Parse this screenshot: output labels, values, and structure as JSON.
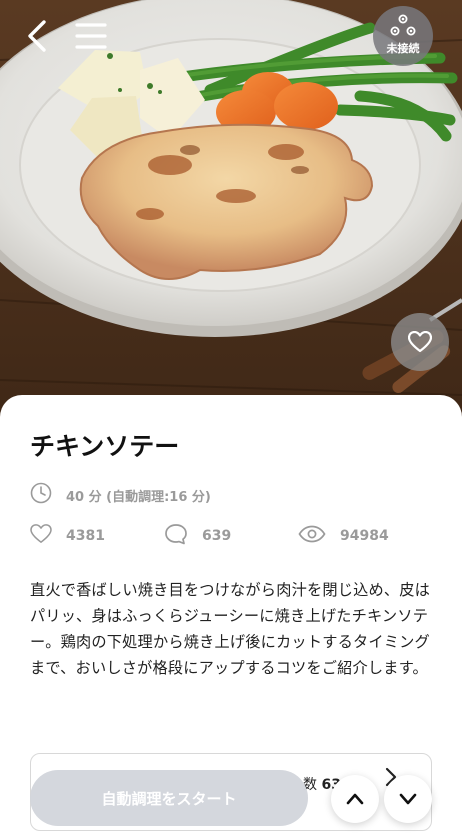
{
  "header": {
    "back_icon": "chevron-left-icon",
    "menu_icon": "hamburger-menu-icon",
    "connection_status": "未接続",
    "connection_icon": "network-nodes-icon",
    "favorite_icon": "heart-icon"
  },
  "recipe": {
    "title": "チキンソテー",
    "time": "40 分 (自動調理:16 分)",
    "likes": "4381",
    "comments": "639",
    "views": "94984",
    "description": "直火で香ばしい焼き目をつけながら肉汁を閉じ込め、皮はパリッ、身はふっくらジューシーに焼き上げたチキンソテー。鶏肉の下処理から焼き上げ後にカットするタイミングまで、おいしさが格段にアップするコツをご紹介します。"
  },
  "info_box": {
    "servings_label": "数",
    "servings_value": "63"
  },
  "footer": {
    "start_label": "自動調理をスタート",
    "scroll_up_icon": "chevron-up-icon",
    "scroll_down_icon": "chevron-down-icon"
  },
  "colors": {
    "accent_gray": "#9a9a9a",
    "start_button_disabled": "#d3d6dc"
  }
}
